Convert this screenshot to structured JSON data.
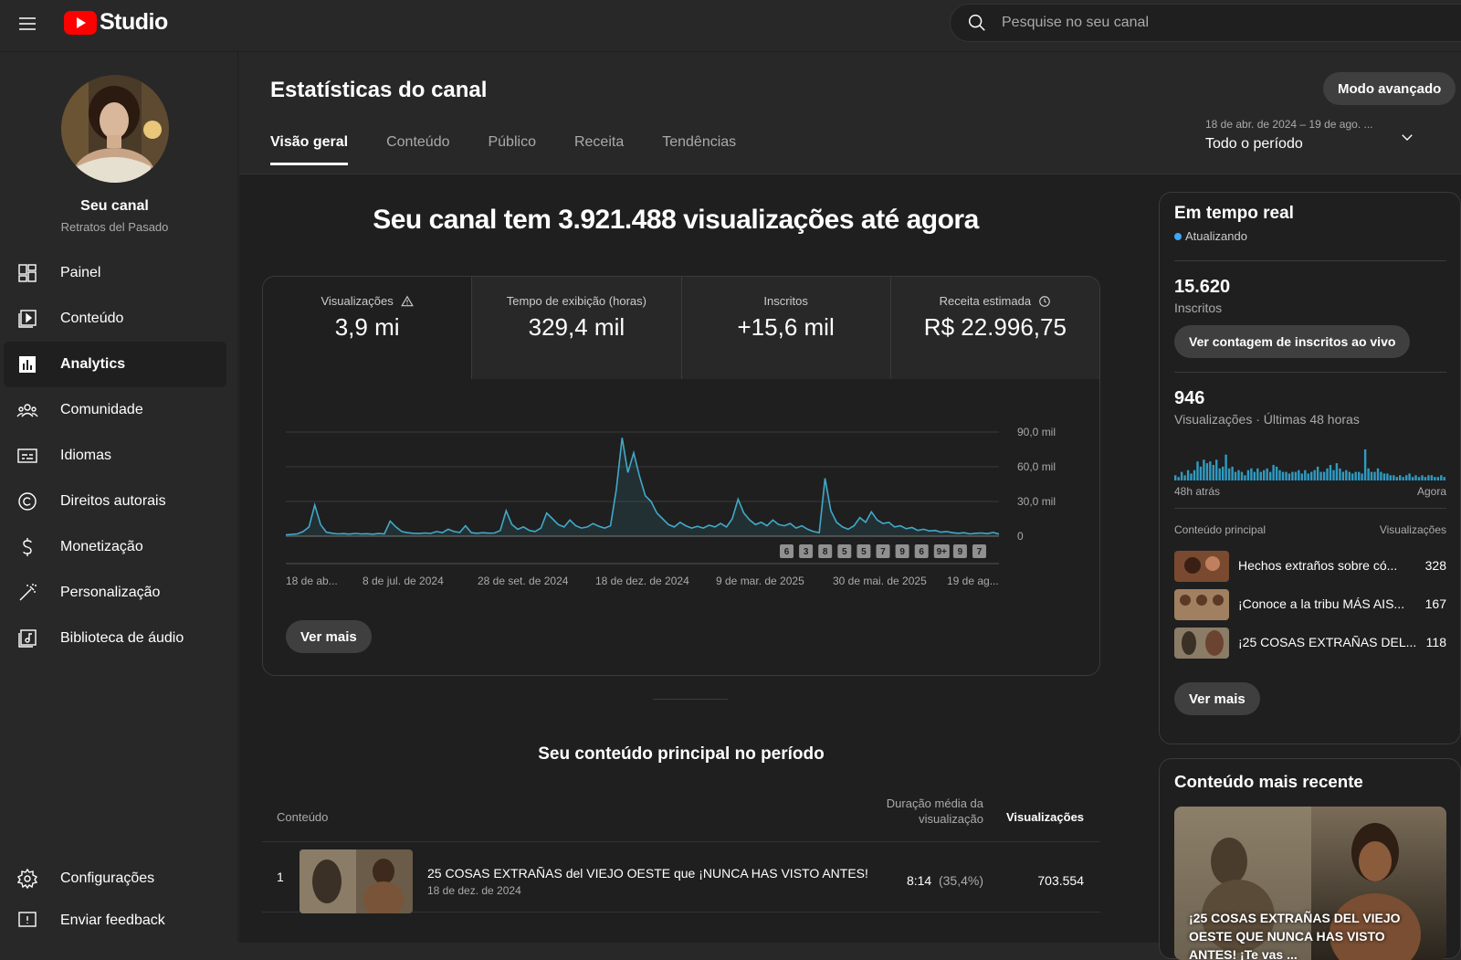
{
  "topbar": {
    "logo_text": "Studio",
    "search_placeholder": "Pesquise no seu canal"
  },
  "sidebar": {
    "channel_name": "Seu canal",
    "channel_handle": "Retratos del Pasado",
    "items": [
      {
        "label": "Painel",
        "icon": "dashboard-icon"
      },
      {
        "label": "Conteúdo",
        "icon": "content-icon"
      },
      {
        "label": "Analytics",
        "icon": "analytics-icon",
        "active": true
      },
      {
        "label": "Comunidade",
        "icon": "community-icon"
      },
      {
        "label": "Idiomas",
        "icon": "subtitles-icon"
      },
      {
        "label": "Direitos autorais",
        "icon": "copyright-icon"
      },
      {
        "label": "Monetização",
        "icon": "dollar-icon"
      },
      {
        "label": "Personalização",
        "icon": "magic-wand-icon"
      },
      {
        "label": "Biblioteca de áudio",
        "icon": "audio-library-icon"
      }
    ],
    "bottom_items": [
      {
        "label": "Configurações",
        "icon": "gear-icon"
      },
      {
        "label": "Enviar feedback",
        "icon": "feedback-icon"
      }
    ]
  },
  "header": {
    "title": "Estatísticas do canal",
    "advanced_button": "Modo avançado",
    "tabs": [
      "Visão geral",
      "Conteúdo",
      "Público",
      "Receita",
      "Tendências"
    ],
    "period_range": "18 de abr. de 2024 – 19 de ago. ...",
    "period_label": "Todo o período"
  },
  "overview": {
    "headline": "Seu canal tem 3.921.488 visualizações até agora",
    "metrics": [
      {
        "label": "Visualizações",
        "value": "3,9 mi"
      },
      {
        "label": "Tempo de exibição (horas)",
        "value": "329,4 mil"
      },
      {
        "label": "Inscritos",
        "value": "+15,6 mil"
      },
      {
        "label": "Receita estimada",
        "value": "R$ 22.996,75"
      }
    ],
    "ver_mais": "Ver mais"
  },
  "chart_data": {
    "type": "line",
    "title": "",
    "y_ticks": [
      "90,0 mil",
      "60,0 mil",
      "30,0 mil",
      "0"
    ],
    "ylim": [
      0,
      90000
    ],
    "x_ticks": [
      "18 de ab...",
      "8 de jul. de 2024",
      "28 de set. de 2024",
      "18 de dez. de 2024",
      "9 de mar. de 2025",
      "30 de mai. de 2025",
      "19 de ag..."
    ],
    "series": [
      {
        "values": [
          1200,
          1500,
          2000,
          4000,
          8000,
          27000,
          10000,
          3500,
          2500,
          2000,
          2200,
          1800,
          2400,
          1900,
          2100,
          1700,
          2300,
          2000,
          13000,
          8000,
          4000,
          3000,
          2500,
          2300,
          2800,
          2400,
          4000,
          3000,
          6000,
          4000,
          3200,
          9000,
          3000,
          2500,
          3000,
          2600,
          2800,
          5000,
          22000,
          10000,
          6000,
          8000,
          5000,
          4000,
          7000,
          20000,
          15000,
          10000,
          8000,
          14000,
          9000,
          7000,
          8000,
          11000,
          8500,
          7000,
          9000,
          40000,
          85000,
          55000,
          72000,
          52000,
          35000,
          30000,
          20000,
          15000,
          10000,
          8000,
          12000,
          9000,
          7000,
          8500,
          7000,
          9500,
          8000,
          11000,
          8000,
          15000,
          32000,
          20000,
          14000,
          10000,
          12000,
          9000,
          14000,
          10000,
          9000,
          11000,
          7000,
          9000,
          6000,
          4000,
          3000,
          50000,
          22000,
          12000,
          8000,
          6000,
          9000,
          16000,
          12000,
          21000,
          14000,
          11000,
          12000,
          8000,
          9000,
          6500,
          7500,
          5000,
          6000,
          4500,
          5000,
          3500,
          4000,
          3000,
          2500,
          3000,
          2000,
          2500,
          2800,
          2200,
          3200,
          1800
        ]
      }
    ],
    "annotations": [
      "6",
      "3",
      "8",
      "5",
      "5",
      "7",
      "9",
      "6",
      "9+",
      "9",
      "7"
    ]
  },
  "top_content": {
    "title": "Seu conteúdo principal no período",
    "col_content": "Conteúdo",
    "col_avg_duration": "Duração média da visualização",
    "col_views": "Visualizações",
    "rows": [
      {
        "rank": "1",
        "title": "25 COSAS EXTRAÑAS del VIEJO OESTE que ¡NUNCA HAS VISTO ANTES!",
        "date": "18 de dez. de 2024",
        "avg_duration": "8:14",
        "avg_pct": "(35,4%)",
        "views": "703.554"
      }
    ]
  },
  "realtime": {
    "title": "Em tempo real",
    "status": "Atualizando",
    "subscribers_value": "15.620",
    "subscribers_label": "Inscritos",
    "live_button": "Ver contagem de inscritos ao vivo",
    "views_value": "946",
    "views_label": "Visualizações · Últimas 48 horas",
    "bar_left": "48h atrás",
    "bar_right": "Agora",
    "bars": [
      3,
      2,
      5,
      3,
      6,
      4,
      6,
      11,
      8,
      12,
      10,
      11,
      9,
      12,
      7,
      8,
      15,
      7,
      8,
      5,
      6,
      5,
      3,
      6,
      7,
      5,
      7,
      5,
      6,
      7,
      5,
      9,
      8,
      6,
      5,
      5,
      4,
      5,
      5,
      6,
      4,
      6,
      4,
      5,
      6,
      8,
      5,
      5,
      7,
      9,
      6,
      10,
      7,
      5,
      6,
      5,
      4,
      5,
      5,
      4,
      18,
      7,
      5,
      5,
      7,
      5,
      4,
      4,
      3,
      3,
      2,
      3,
      2,
      3,
      4,
      2,
      3,
      2,
      3,
      2,
      3,
      3,
      2,
      2,
      3,
      2
    ],
    "top_header_left": "Conteúdo principal",
    "top_header_right": "Visualizações",
    "top_items": [
      {
        "title": "Hechos extraños sobre có...",
        "views": "328"
      },
      {
        "title": "¡Conoce a la tribu MÁS AIS...",
        "views": "167"
      },
      {
        "title": "¡25 COSAS EXTRAÑAS DEL...",
        "views": "118"
      }
    ],
    "ver_mais": "Ver mais"
  },
  "recent": {
    "title": "Conteúdo mais recente",
    "video_title": "¡25 COSAS EXTRAÑAS DEL VIEJO OESTE QUE NUNCA HAS VISTO ANTES! ¡Te vas ..."
  },
  "colors": {
    "accent": "#3ea6ff",
    "line": "#41a9c9",
    "youtube_red": "#ff0000",
    "realtime_bar": "#2f9bc3"
  }
}
